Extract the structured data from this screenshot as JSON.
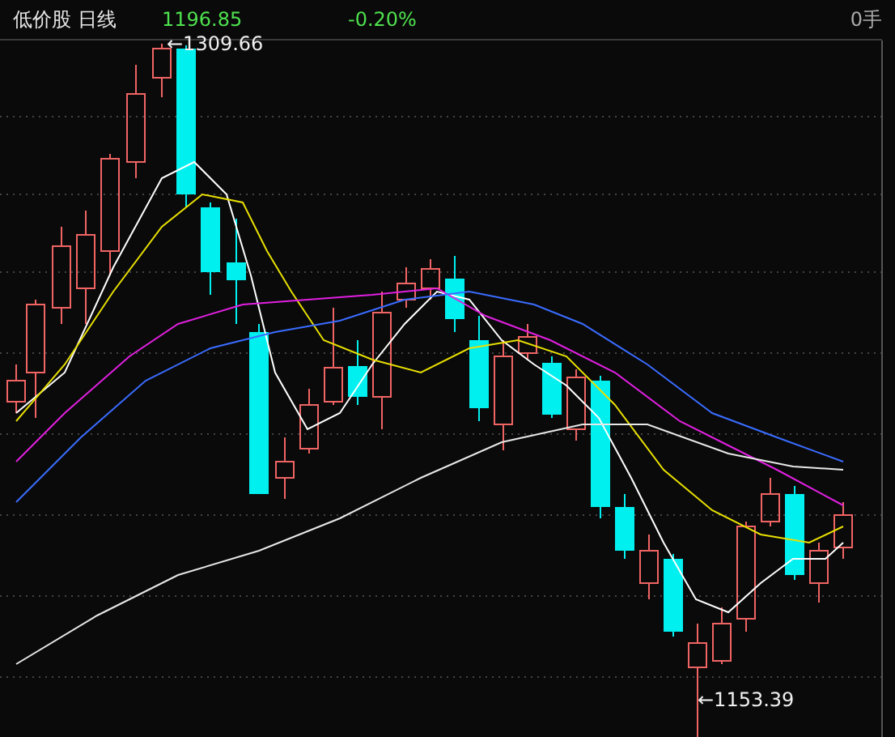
{
  "header": {
    "title": "低价股 日线",
    "price": "1196.85",
    "change": "-0.20%",
    "volume": "0手"
  },
  "chart": {
    "high_label": "←1309.66",
    "low_label": "←1153.39"
  }
}
